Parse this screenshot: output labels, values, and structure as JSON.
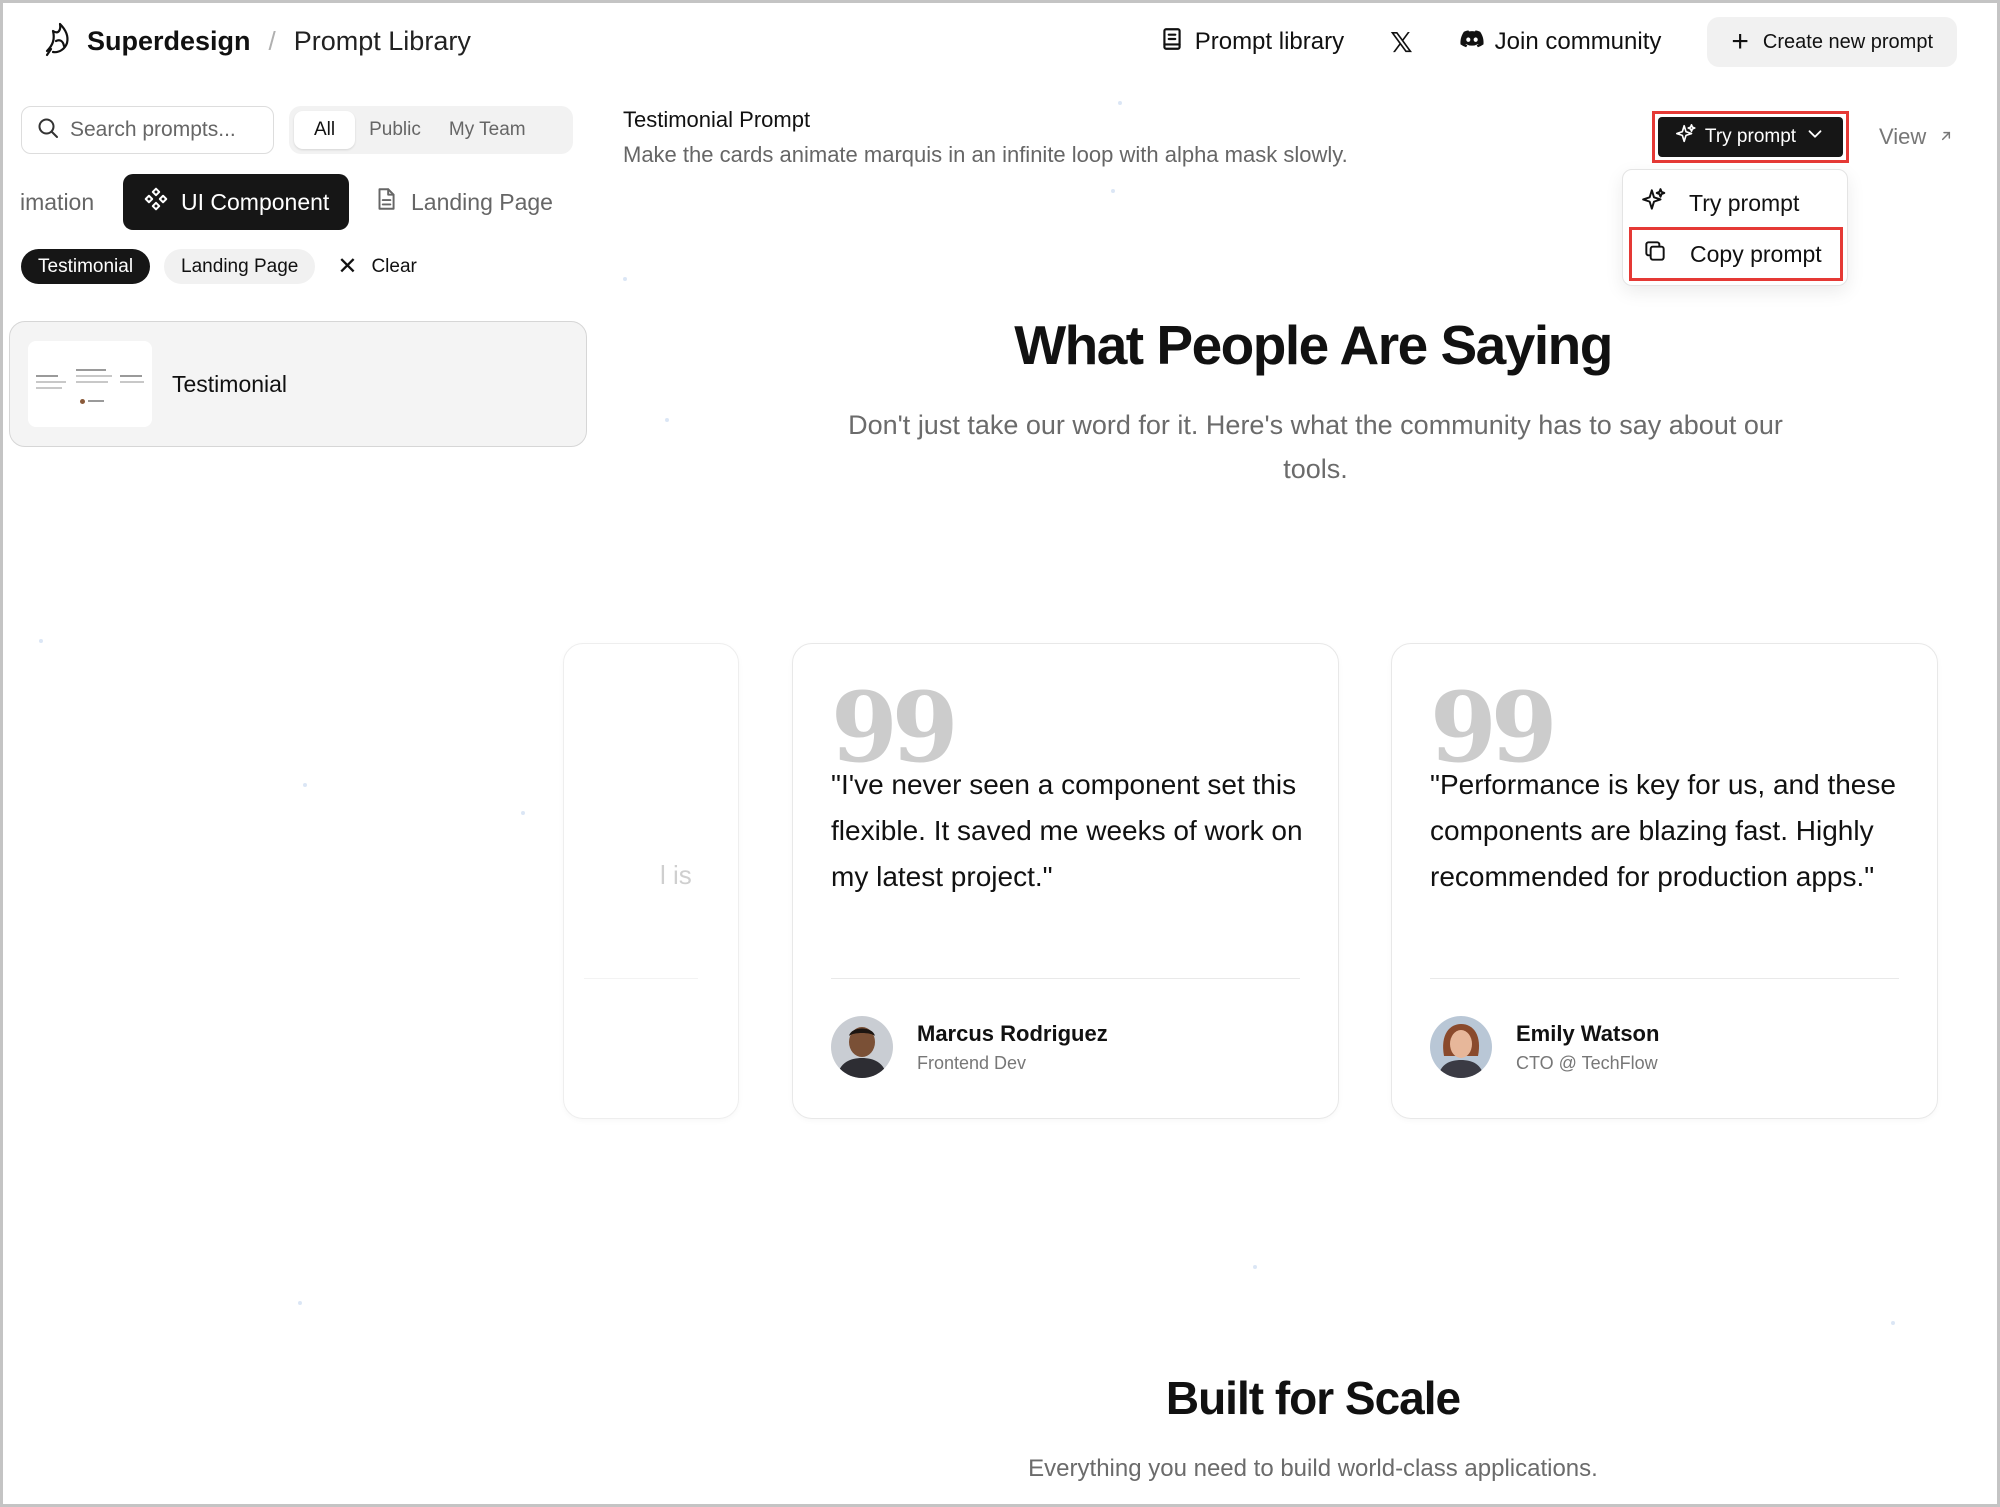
{
  "header": {
    "brand": "Superdesign",
    "separator": "/",
    "page": "Prompt Library",
    "nav": {
      "prompt_library": "Prompt library",
      "join_community": "Join community",
      "create": "Create new prompt"
    }
  },
  "sidebar": {
    "search_placeholder": "Search prompts...",
    "filters": [
      "All",
      "Public",
      "My Team"
    ],
    "categories": [
      "imation",
      "UI Component",
      "Landing Page"
    ],
    "active_tags": [
      "Testimonial",
      "Landing Page"
    ],
    "clear_label": "Clear",
    "results": [
      {
        "title": "Testimonial"
      }
    ]
  },
  "preview": {
    "title": "Testimonial Prompt",
    "description": "Make the cards animate marquis in an infinite loop with alpha mask slowly.",
    "try_button": "Try prompt",
    "view_link": "View",
    "menu": {
      "try": "Try prompt",
      "copy": "Copy prompt"
    },
    "heading": "What People Are Saying",
    "subheading": "Don't just take our word for it. Here's what the community has to say about our tools.",
    "ghost_fragment": "l is",
    "testimonials": [
      {
        "quote": "\"I've never seen a component set this flexible. It saved me weeks of work on my latest project.\"",
        "name": "Marcus Rodriguez",
        "role": "Frontend Dev"
      },
      {
        "quote": "\"Performance is key for us, and these components are blazing fast. Highly recommended for production apps.\"",
        "name": "Emily Watson",
        "role": "CTO @ TechFlow"
      }
    ],
    "section2_heading": "Built for Scale",
    "section2_sub": "Everything you need to build world-class applications."
  },
  "colors": {
    "highlight": "#e53935",
    "primary_dark": "#161616",
    "muted_text": "#6b6b6b"
  },
  "icons": [
    "superdesign-logo-icon",
    "book-icon",
    "x-logo-icon",
    "discord-icon",
    "plus-icon",
    "search-icon",
    "component-icon",
    "document-icon",
    "close-icon",
    "sparkle-icon",
    "chevron-down-icon",
    "arrow-up-right-icon",
    "copy-icon",
    "quote-icon"
  ]
}
